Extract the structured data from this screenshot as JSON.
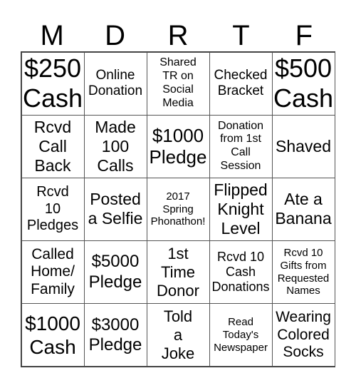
{
  "header": [
    "M",
    "D",
    "R",
    "T",
    "F"
  ],
  "cells": [
    [
      "$250\nCash",
      "Online\nDonation",
      "Shared\nTR on\nSocial\nMedia",
      "Checked\nBracket",
      "$500\nCash"
    ],
    [
      "Rcvd\nCall\nBack",
      "Made\n100\nCalls",
      "$1000\nPledge",
      "Donation\nfrom 1st\nCall\nSession",
      "Shaved"
    ],
    [
      "Rcvd\n10\nPledges",
      "Posted\na Selfie",
      "2017\nSpring\nPhonathon!",
      "Flipped\nKnight\nLevel",
      "Ate a\nBanana"
    ],
    [
      "Called\nHome/\nFamily",
      "$5000\nPledge",
      "1st\nTime\nDonor",
      "Rcvd 10\nCash\nDonations",
      "Rcvd 10\nGifts from\nRequested\nNames"
    ],
    [
      "$1000\nCash",
      "$3000\nPledge",
      "Told\na\nJoke",
      "Read\nToday's\nNewspaper",
      "Wearing\nColored\nSocks"
    ]
  ]
}
